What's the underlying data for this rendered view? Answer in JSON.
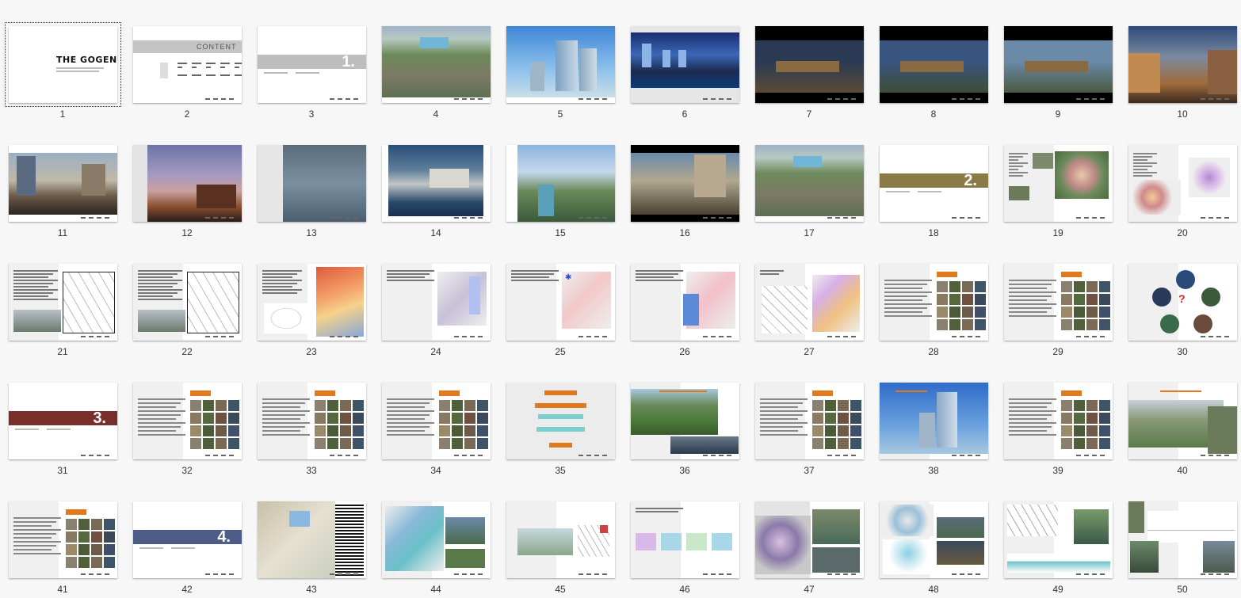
{
  "window": {
    "view": "slide-sorter"
  },
  "cover": {
    "logo_text": "THE GOGEN"
  },
  "content_page": {
    "heading": "CONTENT"
  },
  "section_numbers": {
    "s1": "1.",
    "s2": "2.",
    "s3": "3.",
    "s4": "4."
  },
  "slides": [
    {
      "n": "1",
      "type": "cover"
    },
    {
      "n": "2",
      "type": "contents"
    },
    {
      "n": "3",
      "type": "section",
      "section": "1.",
      "band": "#bdbdbd"
    },
    {
      "n": "4",
      "type": "aerial"
    },
    {
      "n": "5",
      "type": "tower"
    },
    {
      "n": "6",
      "type": "night-tower"
    },
    {
      "n": "7",
      "type": "dark-photo",
      "sky": "#2a3a55",
      "ground": "#5a4a35"
    },
    {
      "n": "8",
      "type": "dark-photo",
      "sky": "#3a5480",
      "ground": "#3d4d35"
    },
    {
      "n": "9",
      "type": "dark-photo",
      "sky": "#6a8aa8",
      "ground": "#4a5a40"
    },
    {
      "n": "10",
      "type": "street"
    },
    {
      "n": "11",
      "type": "street2"
    },
    {
      "n": "12",
      "type": "sunset"
    },
    {
      "n": "13",
      "type": "mist"
    },
    {
      "n": "14",
      "type": "pool"
    },
    {
      "n": "15",
      "type": "river"
    },
    {
      "n": "16",
      "type": "fountain"
    },
    {
      "n": "17",
      "type": "aerial"
    },
    {
      "n": "18",
      "type": "section",
      "section": "2.",
      "band": "#8a7a45"
    },
    {
      "n": "19",
      "type": "analysis"
    },
    {
      "n": "20",
      "type": "analysis2"
    },
    {
      "n": "21",
      "type": "map"
    },
    {
      "n": "22",
      "type": "map"
    },
    {
      "n": "23",
      "type": "red-map"
    },
    {
      "n": "24",
      "type": "site"
    },
    {
      "n": "25",
      "type": "site2"
    },
    {
      "n": "26",
      "type": "site3"
    },
    {
      "n": "27",
      "type": "diagrams"
    },
    {
      "n": "28",
      "type": "photo-grid"
    },
    {
      "n": "29",
      "type": "photo-grid"
    },
    {
      "n": "30",
      "type": "circles"
    },
    {
      "n": "31",
      "type": "section",
      "section": "3.",
      "band": "#7a2e2a"
    },
    {
      "n": "32",
      "type": "photo-grid"
    },
    {
      "n": "33",
      "type": "photo-grid"
    },
    {
      "n": "34",
      "type": "photo-grid"
    },
    {
      "n": "35",
      "type": "text-boxes"
    },
    {
      "n": "36",
      "type": "golf"
    },
    {
      "n": "37",
      "type": "photo-grid"
    },
    {
      "n": "38",
      "type": "tower2"
    },
    {
      "n": "39",
      "type": "photo-grid"
    },
    {
      "n": "40",
      "type": "aerial2"
    },
    {
      "n": "41",
      "type": "photo-grid"
    },
    {
      "n": "42",
      "type": "section",
      "section": "4.",
      "band": "#4d5d88"
    },
    {
      "n": "43",
      "type": "plan-map"
    },
    {
      "n": "44",
      "type": "plan"
    },
    {
      "n": "45",
      "type": "plan2"
    },
    {
      "n": "46",
      "type": "process"
    },
    {
      "n": "47",
      "type": "plan3"
    },
    {
      "n": "48",
      "type": "plan4"
    },
    {
      "n": "49",
      "type": "section-drawing"
    },
    {
      "n": "50",
      "type": "elevation"
    }
  ]
}
